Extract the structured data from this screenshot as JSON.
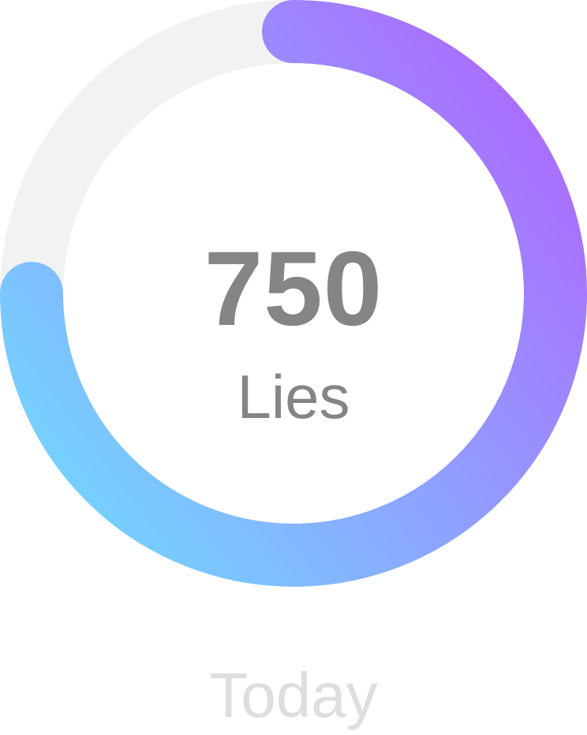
{
  "ring": {
    "progress": 0.75,
    "track_color": "#f2f2f2",
    "gradient_start_color": "#6fdcff",
    "gradient_end_color": "#a970ff"
  },
  "summary": {
    "count": "750",
    "unit": "Lies"
  },
  "period": {
    "label": "Today"
  }
}
